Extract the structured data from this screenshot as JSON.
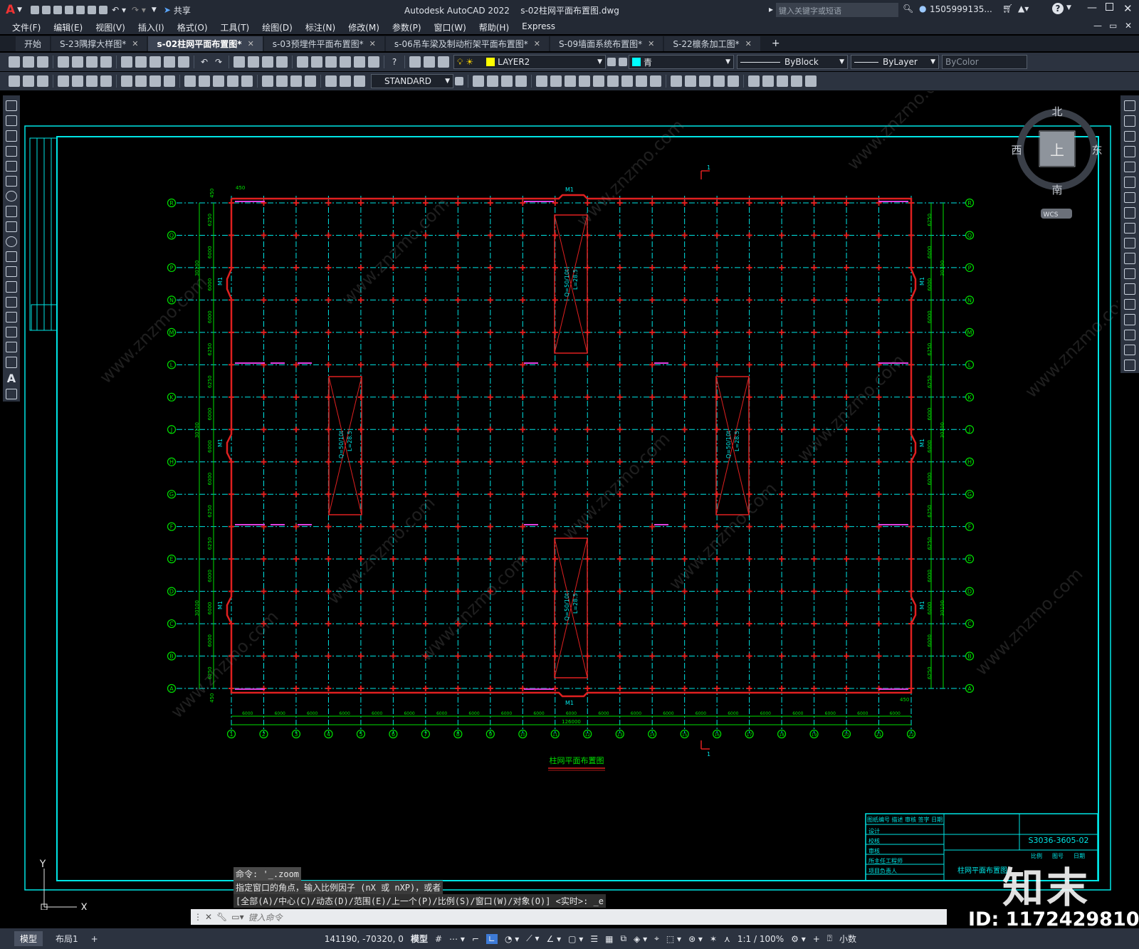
{
  "app": {
    "window_title": "Autodesk AutoCAD 2022",
    "file_name": "s-02柱网平面布置图.dwg",
    "share_label": "共享",
    "search_placeholder": "键入关键字或短语",
    "user": "1505999135...",
    "logo_letter": "A"
  },
  "menu": [
    "文件(F)",
    "编辑(E)",
    "视图(V)",
    "插入(I)",
    "格式(O)",
    "工具(T)",
    "绘图(D)",
    "标注(N)",
    "修改(M)",
    "参数(P)",
    "窗口(W)",
    "帮助(H)",
    "Express"
  ],
  "tabs": [
    {
      "label": "开始",
      "active": false,
      "closable": false
    },
    {
      "label": "S-23隅撑大样图*",
      "active": false,
      "closable": true
    },
    {
      "label": "s-02柱网平面布置图*",
      "active": true,
      "closable": true
    },
    {
      "label": "s-03预埋件平面布置图*",
      "active": false,
      "closable": true
    },
    {
      "label": "s-06吊车梁及制动桁架平面布置图*",
      "active": false,
      "closable": true
    },
    {
      "label": "S-09墙面系统布置图*",
      "active": false,
      "closable": true
    },
    {
      "label": "S-22檩条加工图*",
      "active": false,
      "closable": true
    }
  ],
  "toolbar": {
    "layer": "LAYER2",
    "color": "青",
    "linetype": "ByBlock",
    "lineweight": "ByLayer",
    "plotstyle": "ByColor",
    "text_style": "STANDARD"
  },
  "viewcube": {
    "north": "北",
    "south": "南",
    "east": "东",
    "west": "西",
    "top": "上",
    "wcs": "WCS"
  },
  "drawing": {
    "title": "柱网平面布置图",
    "crane_label_1": "Q=50/10t",
    "crane_label_2": "L=28.5",
    "door_label": "M1",
    "section_mark": "1",
    "total_dim": "126000",
    "bay_dim": "6000",
    "edge_dim": "450",
    "rows": [
      "R",
      "Q",
      "P",
      "N",
      "M",
      "L",
      "K",
      "J",
      "H",
      "G",
      "F",
      "E",
      "D",
      "C",
      "B",
      "A"
    ],
    "row_dims": [
      "6250",
      "6000",
      "6000",
      "6000",
      "6250",
      "6250",
      "6000",
      "6000",
      "6000",
      "6250",
      "6250",
      "6000",
      "6000",
      "6000",
      "6250"
    ],
    "span_dim": "30100",
    "cols": [
      "1",
      "2",
      "3",
      "4",
      "5",
      "6",
      "7",
      "8",
      "9",
      "10",
      "11",
      "12",
      "13",
      "14",
      "15",
      "16",
      "17",
      "18",
      "19",
      "20",
      "21",
      "22"
    ],
    "titleblock_code": "S3036-3605-02",
    "titleblock_name": "柱网平面布置图",
    "titleblock_rows": [
      "设计",
      "校核",
      "审核",
      "所主任工程师",
      "项目负责人"
    ],
    "titleblock_top": "图纸编号 描述 审核 签字 日期",
    "titleblock_meta": [
      "比例",
      "图号",
      "日期"
    ]
  },
  "watermark": {
    "text": "www.znzmo.com",
    "brand": "知末",
    "id": "ID: 1172429810"
  },
  "command": {
    "line1": "命令: '_.zoom",
    "line2": "指定窗口的角点，输入比例因子 (nX 或 nXP)，或者",
    "line3": "[全部(A)/中心(C)/动态(D)/范围(E)/上一个(P)/比例(S)/窗口(W)/对象(O)] <实时>: _e",
    "input_placeholder": "键入命令"
  },
  "status": {
    "coords": "141190, -70320, 0",
    "model": "模型",
    "scale": "1:1 / 100%",
    "units": "小数",
    "tab_model": "模型",
    "tab_layout": "布局1",
    "add": "+"
  },
  "ucs": {
    "x": "X",
    "y": "Y"
  },
  "colors": {
    "bg": "#000000",
    "grid": "#00e5e5",
    "wall": "#e02020",
    "dim": "#00e000",
    "magenta": "#e040e0"
  }
}
